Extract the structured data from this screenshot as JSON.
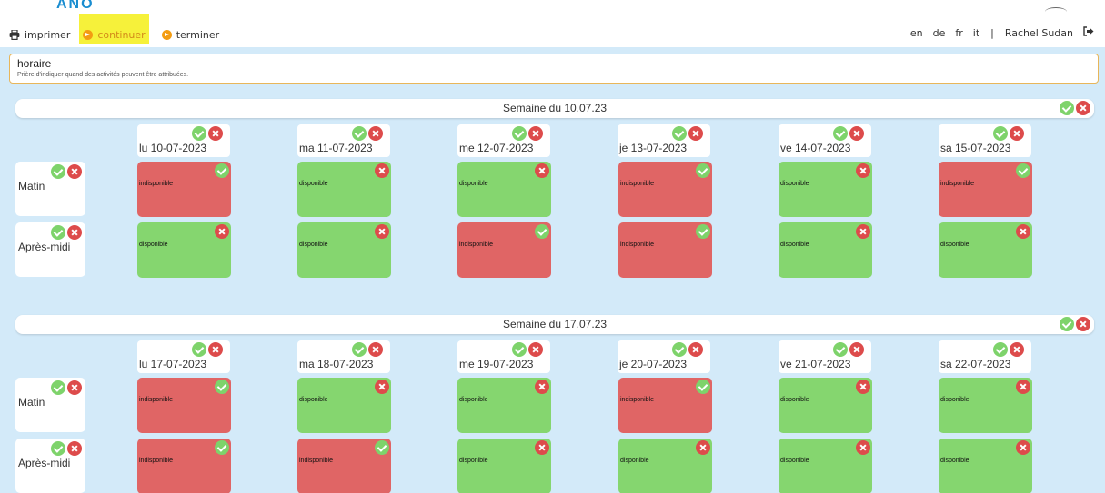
{
  "toolbar": {
    "logo_text": "ANO",
    "print_label": "imprimer",
    "continue_label": "continuer",
    "finish_label": "terminer"
  },
  "languages": [
    "en",
    "de",
    "fr",
    "it"
  ],
  "separator": "|",
  "user_name": "Rachel Sudan",
  "info": {
    "title": "horaire",
    "subtitle": "Prière d'indiquer quand des activités peuvent être attribuées."
  },
  "periods": [
    "Matin",
    "Après-midi"
  ],
  "weeks": [
    {
      "title": "Semaine du 10.07.23",
      "days": [
        "lu 10-07-2023",
        "ma 11-07-2023",
        "me 12-07-2023",
        "je 13-07-2023",
        "ve 14-07-2023",
        "sa 15-07-2023"
      ],
      "slots": [
        [
          "indisponible",
          "disponible",
          "disponible",
          "indisponible",
          "disponible",
          "indisponible"
        ],
        [
          "disponible",
          "disponible",
          "indisponible",
          "indisponible",
          "disponible",
          "disponible"
        ]
      ]
    },
    {
      "title": "Semaine du 17.07.23",
      "days": [
        "lu 17-07-2023",
        "ma 18-07-2023",
        "me 19-07-2023",
        "je 20-07-2023",
        "ve 21-07-2023",
        "sa 22-07-2023"
      ],
      "slots": [
        [
          "indisponible",
          "disponible",
          "disponible",
          "indisponible",
          "disponible",
          "disponible"
        ],
        [
          "indisponible",
          "indisponible",
          "disponible",
          "disponible",
          "disponible",
          "disponible"
        ]
      ]
    }
  ],
  "colors": {
    "available": "#85d66f",
    "unavailable": "#e06565",
    "highlight": "#f6f13a"
  },
  "icons": [
    "print-icon",
    "continue-arrow-icon",
    "finish-arrow-icon",
    "logout-icon",
    "check-icon",
    "cross-icon"
  ]
}
